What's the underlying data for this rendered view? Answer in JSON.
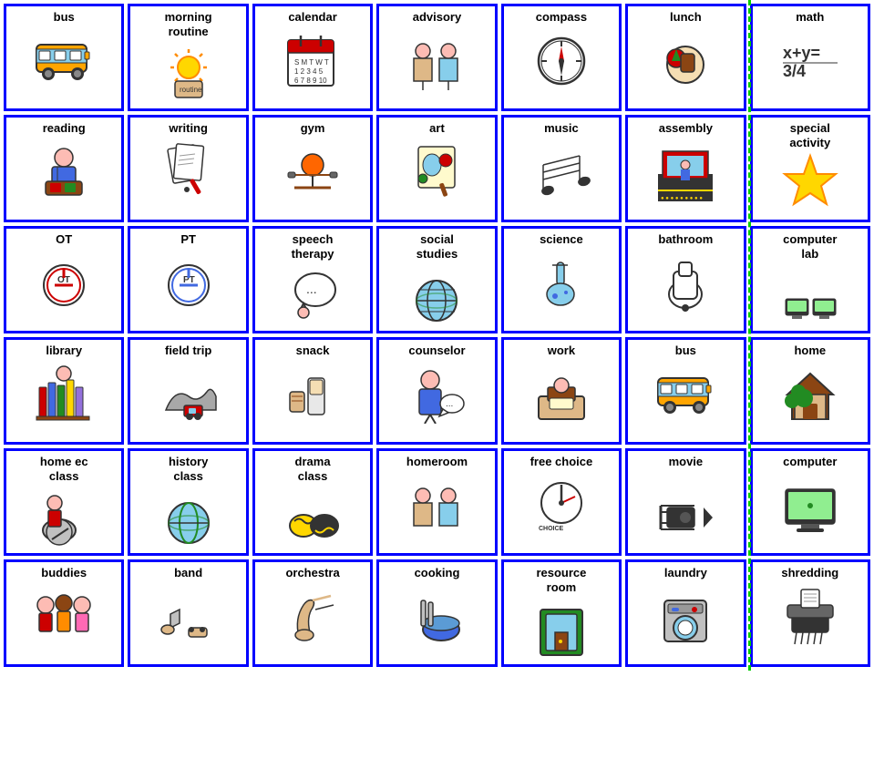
{
  "cards": [
    {
      "id": "bus-1",
      "label": "bus",
      "emoji": "🚌",
      "row": 1
    },
    {
      "id": "morning-routine",
      "label": "morning\nroutine",
      "emoji": "🌅",
      "row": 1
    },
    {
      "id": "calendar",
      "label": "calendar",
      "emoji": "📅",
      "row": 1
    },
    {
      "id": "advisory",
      "label": "advisory",
      "emoji": "👥",
      "row": 1
    },
    {
      "id": "compass",
      "label": "compass",
      "emoji": "🧭",
      "row": 1
    },
    {
      "id": "lunch",
      "label": "lunch",
      "emoji": "🍎",
      "row": 1
    },
    {
      "id": "math",
      "label": "math",
      "emoji": "➗",
      "row": 1
    },
    {
      "id": "reading",
      "label": "reading",
      "emoji": "📖",
      "row": 2
    },
    {
      "id": "writing",
      "label": "writing",
      "emoji": "✏️",
      "row": 2
    },
    {
      "id": "gym",
      "label": "gym",
      "emoji": "🏀",
      "row": 2
    },
    {
      "id": "art",
      "label": "art",
      "emoji": "🎨",
      "row": 2
    },
    {
      "id": "music",
      "label": "music",
      "emoji": "🎵",
      "row": 2
    },
    {
      "id": "assembly",
      "label": "assembly",
      "emoji": "🎭",
      "row": 2
    },
    {
      "id": "special-activity",
      "label": "special\nactivity",
      "emoji": "⭐",
      "row": 2
    },
    {
      "id": "ot",
      "label": "OT",
      "emoji": "🔧",
      "row": 3
    },
    {
      "id": "pt",
      "label": "PT",
      "emoji": "💪",
      "row": 3
    },
    {
      "id": "speech-therapy",
      "label": "speech\ntherapy",
      "emoji": "💬",
      "row": 3
    },
    {
      "id": "social-studies",
      "label": "social\nstudies",
      "emoji": "🌍",
      "row": 3
    },
    {
      "id": "science",
      "label": "science",
      "emoji": "🔬",
      "row": 3
    },
    {
      "id": "bathroom",
      "label": "bathroom",
      "emoji": "🚽",
      "row": 3
    },
    {
      "id": "computer-lab",
      "label": "computer\nlab",
      "emoji": "💻",
      "row": 3
    },
    {
      "id": "library",
      "label": "library",
      "emoji": "📚",
      "row": 4
    },
    {
      "id": "field-trip",
      "label": "field trip",
      "emoji": "🚌",
      "row": 4
    },
    {
      "id": "snack",
      "label": "snack",
      "emoji": "🍪",
      "row": 4
    },
    {
      "id": "counselor",
      "label": "counselor",
      "emoji": "🗣️",
      "row": 4
    },
    {
      "id": "work",
      "label": "work",
      "emoji": "💼",
      "row": 4
    },
    {
      "id": "bus-2",
      "label": "bus",
      "emoji": "🚌",
      "row": 4
    },
    {
      "id": "home",
      "label": "home",
      "emoji": "🏠",
      "row": 4
    },
    {
      "id": "home-ec",
      "label": "home ec\nclass",
      "emoji": "🧺",
      "row": 5
    },
    {
      "id": "history-class",
      "label": "history\nclass",
      "emoji": "🌐",
      "row": 5
    },
    {
      "id": "drama-class",
      "label": "drama\nclass",
      "emoji": "🎭",
      "row": 5
    },
    {
      "id": "homeroom",
      "label": "homeroom",
      "emoji": "🏫",
      "row": 5
    },
    {
      "id": "free-choice",
      "label": "free choice",
      "emoji": "🎯",
      "row": 5
    },
    {
      "id": "movie",
      "label": "movie",
      "emoji": "🎬",
      "row": 5
    },
    {
      "id": "computer",
      "label": "computer",
      "emoji": "🖥️",
      "row": 5
    },
    {
      "id": "buddies",
      "label": "buddies",
      "emoji": "👫",
      "row": 6
    },
    {
      "id": "band",
      "label": "band",
      "emoji": "🎺",
      "row": 6
    },
    {
      "id": "orchestra",
      "label": "orchestra",
      "emoji": "🎻",
      "row": 6
    },
    {
      "id": "cooking",
      "label": "cooking",
      "emoji": "🍳",
      "row": 6
    },
    {
      "id": "resource-room",
      "label": "resource\nroom",
      "emoji": "🏫",
      "row": 6
    },
    {
      "id": "laundry",
      "label": "laundry",
      "emoji": "👕",
      "row": 6
    },
    {
      "id": "shredding",
      "label": "shredding",
      "emoji": "📄",
      "row": 6
    }
  ]
}
